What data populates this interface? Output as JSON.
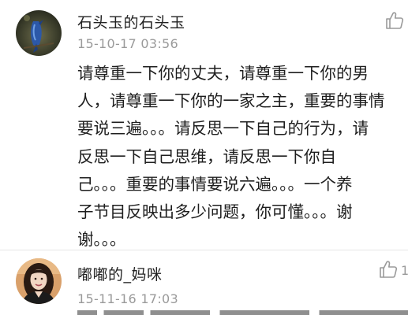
{
  "comments": [
    {
      "username": "石头玉的石头玉",
      "timestamp": "15-10-17 03:56",
      "avatar_icon": "bird-avatar",
      "like_icon": "thumbs-up-icon",
      "body_lines": [
        "请尊重一下你的丈夫，请尊重一下你的男",
        "人，请尊重一下你的一家之主，重要的事情",
        "要说三遍。。。请反思一下自己的行为，请",
        "反思一下自己思维，请反思一下你自",
        "己。。。重要的事情要说六遍。。。一个养",
        "子节目反映出多少问题，你可懂。。。谢",
        "谢。。。"
      ]
    },
    {
      "username": "嘟嘟的_妈咪",
      "timestamp": "15-11-16 17:03",
      "avatar_icon": "woman-avatar",
      "like_icon": "thumbs-up-icon",
      "like_count": "1"
    }
  ],
  "colors": {
    "username": "#222222",
    "timestamp": "#9a9a9a",
    "body": "#1e1e1e",
    "divider": "#e6e6e6",
    "icon": "#9a9a9a"
  }
}
